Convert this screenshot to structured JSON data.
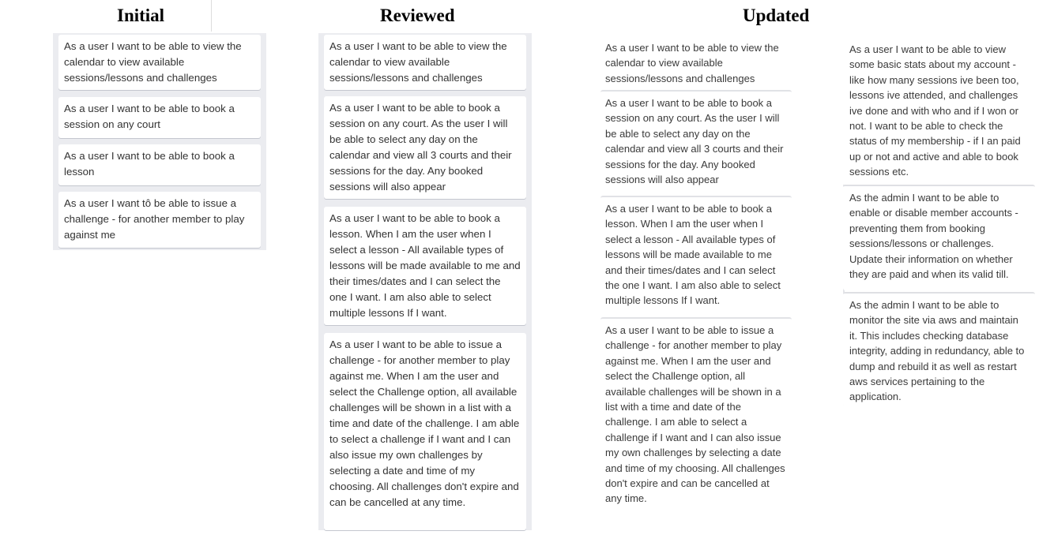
{
  "headings": {
    "initial": "Initial",
    "reviewed": "Reviewed",
    "updated": "Updated"
  },
  "columns": {
    "initial": [
      "As a user I want to be able to view the calendar to view available sessions/lessons and challenges",
      "As a user I want to be able to book a session on any court",
      "As a user I want to be able to book a lesson",
      "As a user I want tô be able to issue a challenge - for another member to play against me"
    ],
    "reviewed": [
      "As a user I want to be able to view the calendar to view available sessions/lessons and challenges",
      "As a user I want to be able to book a session on any court. As the user I will be able to select any day on the calendar and view all 3 courts and their sessions for the day. Any booked sessions will also appear",
      "As a user I want to be able to book a lesson. When I am the user when I select a lesson - All available types of lessons will be made available to me and their times/dates and I can select the one I want. I am also able to select multiple lessons If I want.",
      "As a user I want to be able to issue a challenge - for another member to play against me. When I am the user and select the Challenge option, all available challenges will be shown in a list with a time and date of the challenge. I am able to select a challenge if I want and I can also issue my own challenges by selecting a date and time of my choosing. All challenges don't expire and can be cancelled at any time."
    ],
    "updated_left": [
      "As a user I want to be able to view the calendar to view available sessions/lessons and challenges",
      "As a user I want to be able to book a session on any court. As the user I will be able to select any day on the calendar and view all 3 courts and their sessions for the day. Any booked sessions will also appear",
      "As a user I want to be able to book a lesson. When I am the user when I select a lesson - All available types of lessons will be made available to me and their times/dates and I can select the one I want. I am also able to select multiple lessons If I want.",
      "As a user I want to be able to issue a challenge - for another member to play against me. When I am the user and select the Challenge option, all available challenges will be shown in a list with a time and date of the challenge. I am able to select a challenge if I want and I can also issue my own challenges by selecting a date and time of my choosing. All challenges don't expire and can be cancelled at any time."
    ],
    "updated_right": [
      "As a user I want to be able to view some basic stats about my account - like how many sessions ive been too, lessons ive attended, and challenges ive done and with who and if I won or not. I want to be able to check the status of my membership - if I an paid up or not and active and able to book sessions etc.",
      "As the admin I want to be able to enable or disable member accounts - preventing them from booking sessions/lessons or challenges. Update their information on whether they are paid and when its valid till.",
      "As the admin I want to be able to monitor the site via aws and maintain it. This includes checking database integrity, adding in redundancy, able to dump and rebuild it as well as restart aws services pertaining to the application."
    ]
  }
}
